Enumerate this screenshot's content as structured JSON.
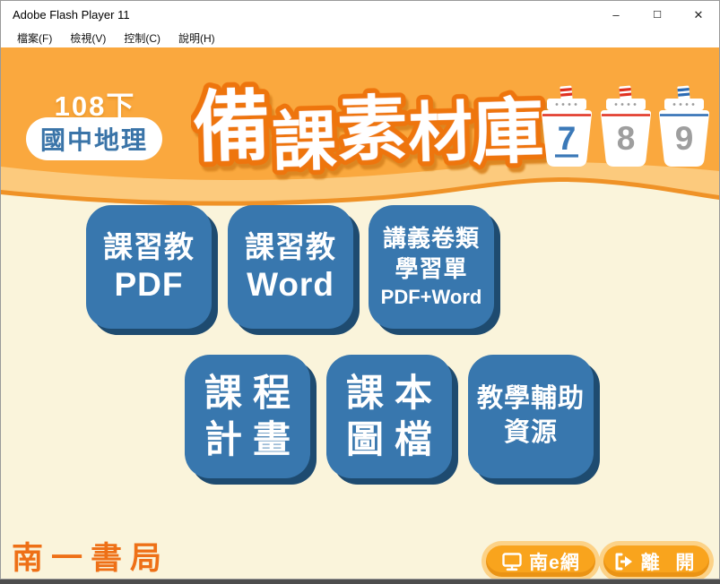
{
  "window": {
    "title": "Adobe Flash Player 11",
    "controls": {
      "minimize": "–",
      "maximize": "☐",
      "close": "✕"
    }
  },
  "menubar": {
    "items": [
      "檔案(F)",
      "檢視(V)",
      "控制(C)",
      "說明(H)"
    ]
  },
  "header": {
    "semester": "108下",
    "subject": "國中地理",
    "title": "備課素材庫",
    "title_chars": [
      "備",
      "課",
      "素",
      "材",
      "庫"
    ],
    "boats": [
      {
        "number": "7",
        "stripe_color": "#e03020",
        "selected": true
      },
      {
        "number": "8",
        "stripe_color": "#e03020",
        "selected": false
      },
      {
        "number": "9",
        "stripe_color": "#2c6bb3",
        "selected": false
      }
    ]
  },
  "buttons": [
    {
      "lines": [
        "課習教",
        "PDF"
      ]
    },
    {
      "lines": [
        "課習教",
        "Word"
      ]
    },
    {
      "lines": [
        "講義卷類",
        "學習單",
        "PDF+Word"
      ]
    },
    {
      "lines": [
        "課程",
        "計畫"
      ]
    },
    {
      "lines": [
        "課本",
        "圖檔"
      ]
    },
    {
      "lines": [
        "教學輔助",
        "資源"
      ]
    }
  ],
  "footer": {
    "publisher": "南一書局",
    "nane_label": "南e網",
    "exit_label": "離 開"
  },
  "colors": {
    "header_orange": "#faa83e",
    "wave_light": "#fcca7d",
    "wave_stripe": "#ef9227",
    "cream_bg": "#faf4db",
    "button_blue": "#3877ae",
    "button_shadow": "#1e4b70",
    "title_outline": "#ee7510",
    "accent_orange": "#f9a41d",
    "number_blue": "#3b79b8",
    "number_gray": "#9e9e9e",
    "publisher_orange": "#ee7017"
  }
}
